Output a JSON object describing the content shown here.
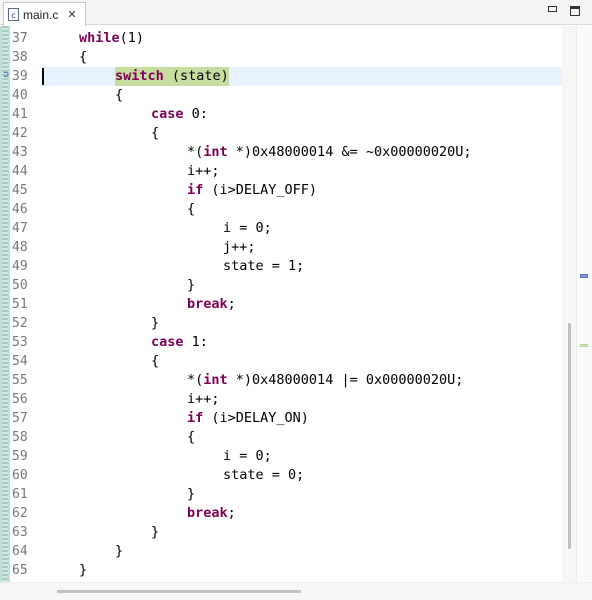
{
  "tab": {
    "label": "main.c",
    "close": "✕",
    "file_icon": "c-file-icon"
  },
  "editor": {
    "current_line": 39,
    "lines": [
      {
        "n": "37",
        "indent": 4,
        "parts": [
          {
            "t": "while",
            "kw": true
          },
          {
            "t": "(1)"
          }
        ]
      },
      {
        "n": "38",
        "indent": 4,
        "parts": [
          {
            "t": "{"
          }
        ]
      },
      {
        "n": "39",
        "indent": 8,
        "parts": [
          {
            "t": "switch",
            "kw": true
          },
          {
            "t": " (state)"
          }
        ],
        "current": true,
        "selected": true
      },
      {
        "n": "40",
        "indent": 8,
        "parts": [
          {
            "t": "{"
          }
        ]
      },
      {
        "n": "41",
        "indent": 12,
        "parts": [
          {
            "t": "case",
            "kw": true
          },
          {
            "t": " 0:"
          }
        ]
      },
      {
        "n": "42",
        "indent": 12,
        "parts": [
          {
            "t": "{"
          }
        ]
      },
      {
        "n": "43",
        "indent": 16,
        "parts": [
          {
            "t": "*("
          },
          {
            "t": "int",
            "kw": true
          },
          {
            "t": " *)0x48000014 &= ~0x00000020U;"
          }
        ]
      },
      {
        "n": "44",
        "indent": 16,
        "parts": [
          {
            "t": "i++;"
          }
        ]
      },
      {
        "n": "45",
        "indent": 16,
        "parts": [
          {
            "t": "if",
            "kw": true
          },
          {
            "t": " (i>DELAY_OFF)"
          }
        ]
      },
      {
        "n": "46",
        "indent": 16,
        "parts": [
          {
            "t": "{"
          }
        ]
      },
      {
        "n": "47",
        "indent": 20,
        "parts": [
          {
            "t": "i = 0;"
          }
        ]
      },
      {
        "n": "48",
        "indent": 20,
        "parts": [
          {
            "t": "j++;"
          }
        ]
      },
      {
        "n": "49",
        "indent": 20,
        "parts": [
          {
            "t": "state = 1;"
          }
        ]
      },
      {
        "n": "50",
        "indent": 16,
        "parts": [
          {
            "t": "}"
          }
        ]
      },
      {
        "n": "51",
        "indent": 16,
        "parts": [
          {
            "t": "break",
            "kw": true
          },
          {
            "t": ";"
          }
        ]
      },
      {
        "n": "52",
        "indent": 12,
        "parts": [
          {
            "t": "}"
          }
        ]
      },
      {
        "n": "53",
        "indent": 12,
        "parts": [
          {
            "t": "case",
            "kw": true
          },
          {
            "t": " 1:"
          }
        ]
      },
      {
        "n": "54",
        "indent": 12,
        "parts": [
          {
            "t": "{"
          }
        ]
      },
      {
        "n": "55",
        "indent": 16,
        "parts": [
          {
            "t": "*("
          },
          {
            "t": "int",
            "kw": true
          },
          {
            "t": " *)0x48000014 |= 0x00000020U;"
          }
        ]
      },
      {
        "n": "56",
        "indent": 16,
        "parts": [
          {
            "t": "i++;"
          }
        ]
      },
      {
        "n": "57",
        "indent": 16,
        "parts": [
          {
            "t": "if",
            "kw": true
          },
          {
            "t": " (i>DELAY_ON)"
          }
        ]
      },
      {
        "n": "58",
        "indent": 16,
        "parts": [
          {
            "t": "{"
          }
        ]
      },
      {
        "n": "59",
        "indent": 20,
        "parts": [
          {
            "t": "i = 0;"
          }
        ]
      },
      {
        "n": "60",
        "indent": 20,
        "parts": [
          {
            "t": "state = 0;"
          }
        ]
      },
      {
        "n": "61",
        "indent": 16,
        "parts": [
          {
            "t": "}"
          }
        ]
      },
      {
        "n": "62",
        "indent": 16,
        "parts": [
          {
            "t": "break",
            "kw": true
          },
          {
            "t": ";"
          }
        ]
      },
      {
        "n": "63",
        "indent": 12,
        "parts": [
          {
            "t": "}"
          }
        ]
      },
      {
        "n": "64",
        "indent": 8,
        "parts": [
          {
            "t": "}"
          }
        ]
      },
      {
        "n": "65",
        "indent": 4,
        "parts": [
          {
            "t": "}"
          }
        ]
      }
    ]
  },
  "colors": {
    "keyword": "#7f0055",
    "current_line": "#e8f2fe",
    "selection": "#c7dc9f",
    "line_number": "#787878"
  },
  "icons": {
    "debug_pointer": "instruction-pointer-icon",
    "minimize": "minimize-icon",
    "maximize": "maximize-icon"
  }
}
